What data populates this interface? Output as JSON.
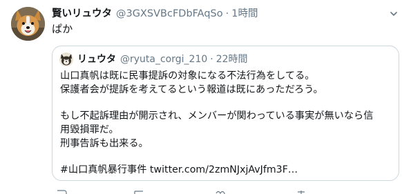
{
  "tweet": {
    "display_name": "賢いリュウタ",
    "handle": "@3GXSVBcFDbFAqSo",
    "separator": "·",
    "time": "1時間",
    "text": "ぱか",
    "avatar_icon": "corgi-avatar-icon",
    "menu_icon": "chevron-down-icon"
  },
  "quote": {
    "display_name": "リュウタ",
    "handle": "@ryuta_corgi_210",
    "separator": "·",
    "time": "22時間",
    "avatar_icon": "corgi-avatar-icon",
    "lines": [
      "山口真帆は既に民事提訴の対象になる不法行為をしてる。",
      "保護者会が提訴を考えてるという報道は既にあっただろう。",
      "もし不起訴理由が開示され、メンバーが関わっている事実が無いなら信",
      "用毀損罪だ。",
      "刑事告訴も出来る。"
    ],
    "hashtag_line": "#山口真帆暴行事件 twitter.com/2zmNJxjAvJfm3F…"
  },
  "colors": {
    "text": "#14171a",
    "muted": "#657786",
    "border": "#ccd6dd"
  }
}
